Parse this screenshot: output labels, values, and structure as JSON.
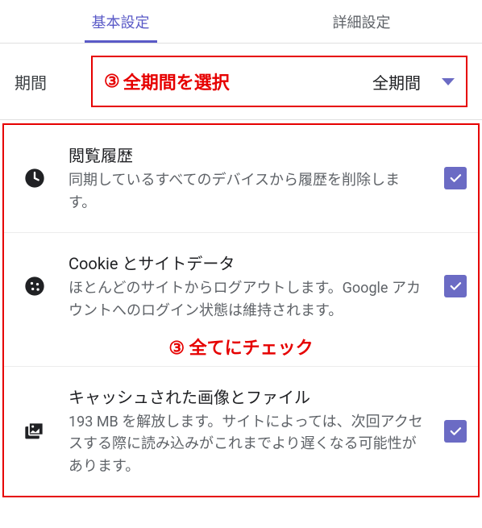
{
  "tabs": {
    "basic": "基本設定",
    "advanced": "詳細設定"
  },
  "time": {
    "label": "期間",
    "selected": "全期間",
    "annotation_num": "③",
    "annotation_text": "全期間を選択"
  },
  "options": [
    {
      "title": "閲覧履歴",
      "desc": "同期しているすべてのデバイスから履歴を削除します。"
    },
    {
      "title": "Cookie とサイトデータ",
      "desc": "ほとんどのサイトからログアウトします。Google アカウントへのログイン状態は維持されます。"
    },
    {
      "title": "キャッシュされた画像とファイル",
      "desc": "193 MB を解放します。サイトによっては、次回アクセスする際に読み込みがこれまでより遅くなる可能性があります。"
    }
  ],
  "mid_annotation": {
    "num": "③",
    "text": "全てにチェック"
  }
}
